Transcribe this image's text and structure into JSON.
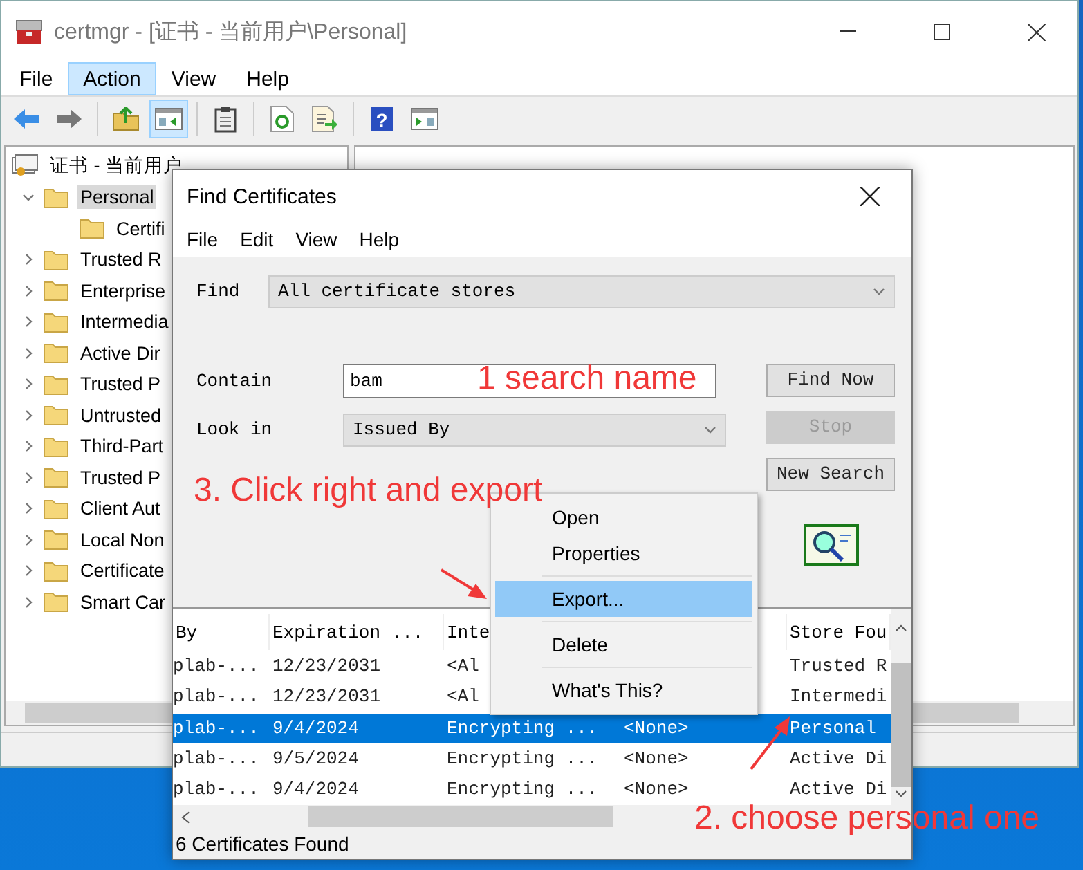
{
  "main_window": {
    "title": "certmgr - [证书 - 当前用户\\Personal]",
    "menu": [
      {
        "label": "File",
        "selected": false
      },
      {
        "label": "Action",
        "selected": true
      },
      {
        "label": "View",
        "selected": false
      },
      {
        "label": "Help",
        "selected": false
      }
    ],
    "toolbar": [
      {
        "kind": "back",
        "pressed": false
      },
      {
        "kind": "forward",
        "pressed": false
      },
      {
        "kind": "separator"
      },
      {
        "kind": "up",
        "pressed": false
      },
      {
        "kind": "tree",
        "pressed": true
      },
      {
        "kind": "separator"
      },
      {
        "kind": "clipboard",
        "pressed": false
      },
      {
        "kind": "separator"
      },
      {
        "kind": "refresh",
        "pressed": false
      },
      {
        "kind": "export",
        "pressed": false
      },
      {
        "kind": "separator"
      },
      {
        "kind": "help",
        "pressed": false,
        "glyph": "?"
      },
      {
        "kind": "pane",
        "pressed": false
      }
    ],
    "tree": {
      "root": "证书 - 当前用户",
      "items": [
        {
          "label": "Personal",
          "selected": true,
          "expanded": true,
          "children": [
            {
              "label": "Certifi",
              "selected": false
            }
          ]
        },
        {
          "label": "Trusted R",
          "selected": false,
          "expanded": false
        },
        {
          "label": "Enterprise",
          "selected": false,
          "expanded": false
        },
        {
          "label": "Intermedia",
          "selected": false,
          "expanded": false
        },
        {
          "label": "Active Dir",
          "selected": false,
          "expanded": false
        },
        {
          "label": "Trusted P",
          "selected": false,
          "expanded": false
        },
        {
          "label": "Untrusted",
          "selected": false,
          "expanded": false
        },
        {
          "label": "Third-Part",
          "selected": false,
          "expanded": false
        },
        {
          "label": "Trusted P",
          "selected": false,
          "expanded": false
        },
        {
          "label": "Client Aut",
          "selected": false,
          "expanded": false
        },
        {
          "label": "Local Non",
          "selected": false,
          "expanded": false
        },
        {
          "label": "Certificate",
          "selected": false,
          "expanded": false
        },
        {
          "label": "Smart Car",
          "selected": false,
          "expanded": false
        }
      ]
    }
  },
  "dialog": {
    "title": "Find Certificates",
    "menu": [
      "File",
      "Edit",
      "View",
      "Help"
    ],
    "find": {
      "label": "Find",
      "value": "All certificate stores"
    },
    "contains": {
      "label": "Contain",
      "value": "bam"
    },
    "look_in": {
      "label": "Look in",
      "value": "Issued By"
    },
    "buttons": [
      {
        "label": "Find Now",
        "disabled": false
      },
      {
        "label": "Stop",
        "disabled": true
      },
      {
        "label": "New Search",
        "disabled": false
      }
    ],
    "results": {
      "columns": [
        "By",
        "Expiration ...",
        "Inte",
        null,
        "Store Fou"
      ],
      "rows": [
        {
          "selected": false,
          "cells": [
            "plab-...",
            "12/23/2031",
            "<Al",
            null,
            "Trusted R"
          ]
        },
        {
          "selected": false,
          "cells": [
            "plab-...",
            "12/23/2031",
            "<Al",
            null,
            "Intermedi"
          ]
        },
        {
          "selected": true,
          "cells": [
            "plab-...",
            "9/4/2024",
            "Encrypting ...",
            "<None>",
            "Personal"
          ]
        },
        {
          "selected": false,
          "cells": [
            "plab-...",
            "9/5/2024",
            "Encrypting ...",
            "<None>",
            "Active Di"
          ]
        },
        {
          "selected": false,
          "cells": [
            "plab-...",
            "9/4/2024",
            "Encrypting ...",
            "<None>",
            "Active Di"
          ]
        }
      ]
    },
    "status": "6 Certificates Found"
  },
  "context_menu": [
    {
      "kind": "item",
      "label": "Open",
      "selected": false
    },
    {
      "kind": "item",
      "label": "Properties",
      "selected": false
    },
    {
      "kind": "separator"
    },
    {
      "kind": "item",
      "label": "Export...",
      "selected": true
    },
    {
      "kind": "separator"
    },
    {
      "kind": "item",
      "label": "Delete",
      "selected": false
    },
    {
      "kind": "separator"
    },
    {
      "kind": "item",
      "label": "What's This?",
      "selected": false
    }
  ],
  "annotations": [
    "1 search name",
    "3. Click right and export",
    "2. choose personal one"
  ]
}
